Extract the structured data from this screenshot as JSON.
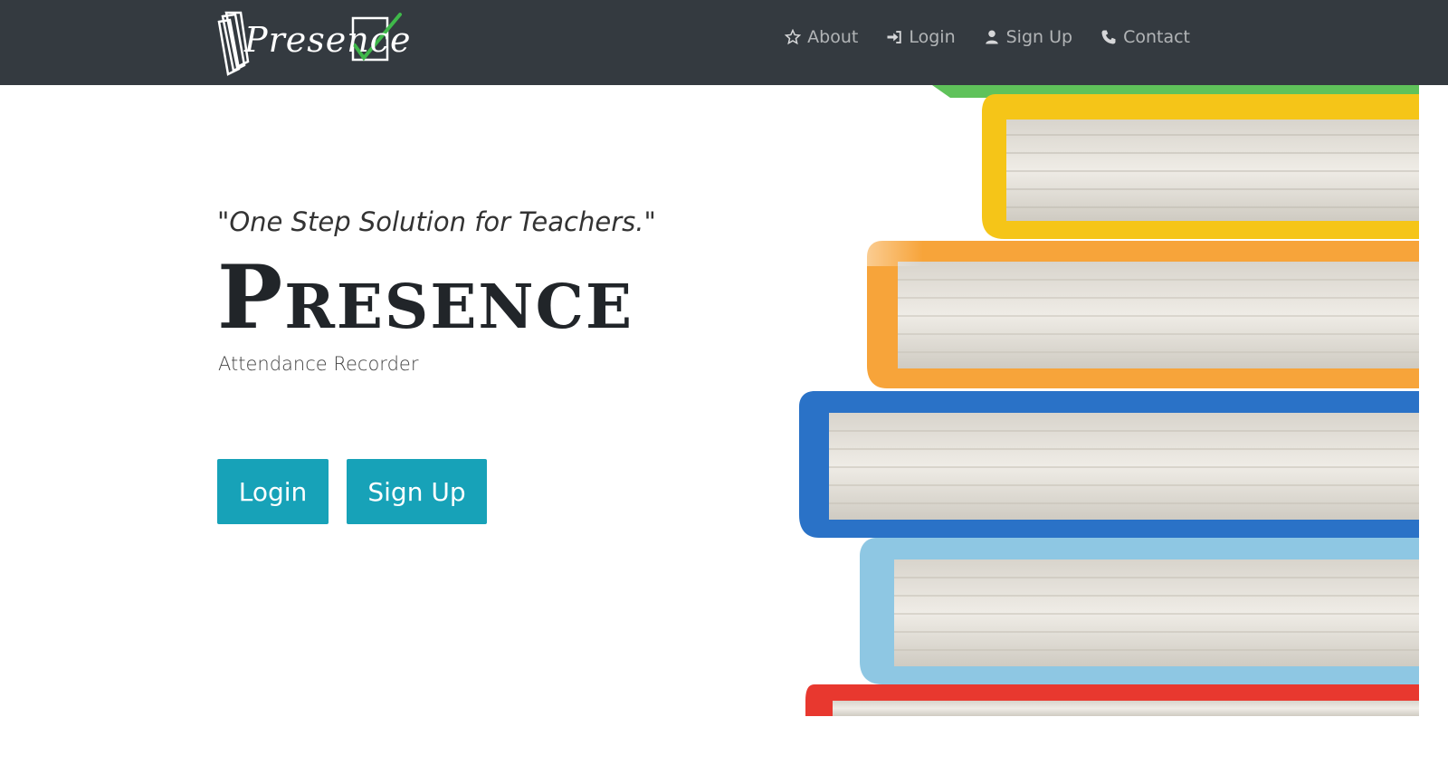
{
  "brand": {
    "logo_text": "Presence"
  },
  "nav": {
    "items": [
      {
        "label": "About",
        "icon": "star-icon"
      },
      {
        "label": "Login",
        "icon": "sign-in-icon"
      },
      {
        "label": "Sign Up",
        "icon": "user-icon"
      },
      {
        "label": "Contact",
        "icon": "phone-icon"
      }
    ]
  },
  "hero": {
    "tagline": "\"One Step Solution for Teachers.\"",
    "title": "Presence",
    "subtitle": "Attendance Recorder",
    "login_label": "Login",
    "signup_label": "Sign Up"
  },
  "colors": {
    "navbar": "#343a40",
    "button": "#17a2b8",
    "nav_text": "rgba(255,255,255,0.62)"
  }
}
